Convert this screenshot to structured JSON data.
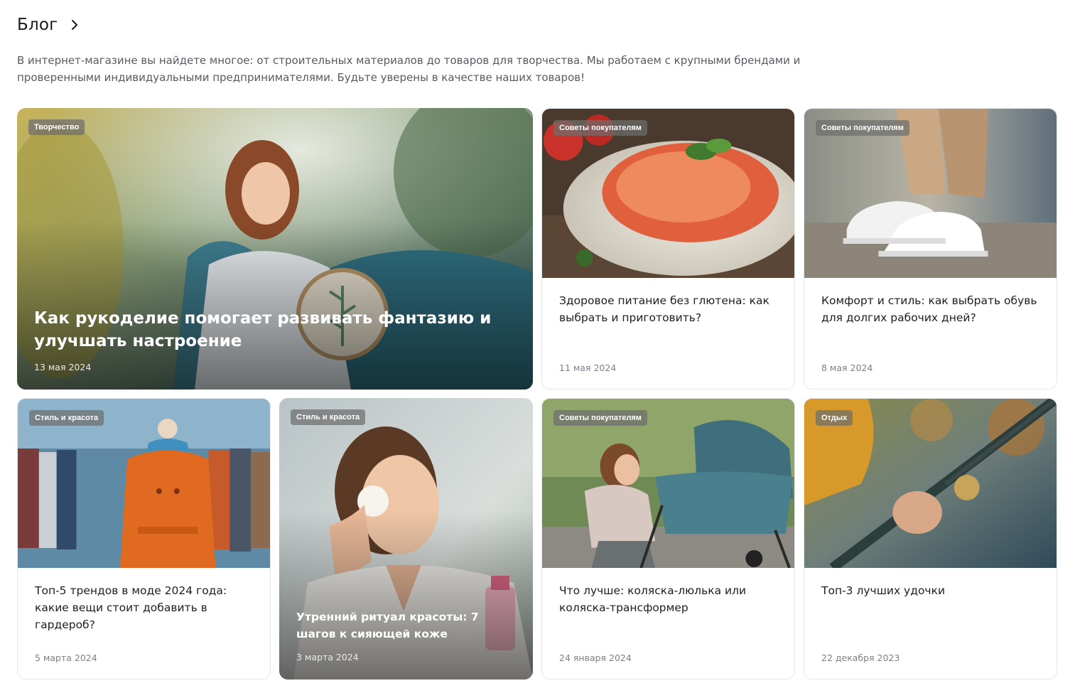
{
  "blog": {
    "title": "Блог",
    "intro": "В интернет-магазине вы найдете многое: от строительных материалов до товаров для творчества. Мы работаем с крупными брендами и проверенными индивидуальными предпринимателями. Будьте уверены в качестве наших товаров!"
  },
  "posts": [
    {
      "tag": "Творчество",
      "title": "Как рукоделие помогает развивать фантазию и улучшать настроение",
      "date": "13 мая 2024",
      "image": "woman-embroidery-photo"
    },
    {
      "tag": "Советы покупателям",
      "title": "Здоровое питание без глютена: как выбрать и приготовить?",
      "date": "11 мая 2024",
      "image": "pasta-plate-photo"
    },
    {
      "tag": "Советы покупателям",
      "title": "Комфорт и стиль: как выбрать обувь для долгих рабочих дней?",
      "date": "8 мая 2024",
      "image": "white-sneakers-photo"
    },
    {
      "tag": "Стиль и красота",
      "title": "Топ-5 трендов в моде 2024 года: какие вещи стоит добавить в гардероб?",
      "date": "5 марта 2024",
      "image": "orange-coat-mannequin-photo"
    },
    {
      "tag": "Стиль и красота",
      "title": "Утренний ритуал красоты: 7 шагов к сияющей коже",
      "date": "3 марта 2024",
      "image": "woman-skincare-photo"
    },
    {
      "tag": "Советы покупателям",
      "title": "Что лучше: коляска-люлька или коляска-трансформер",
      "date": "24 января 2024",
      "image": "woman-with-stroller-photo"
    },
    {
      "tag": "Отдых",
      "title": "Топ-3 лучших удочки",
      "date": "22 декабря 2023",
      "image": "fishing-rod-photo"
    }
  ]
}
